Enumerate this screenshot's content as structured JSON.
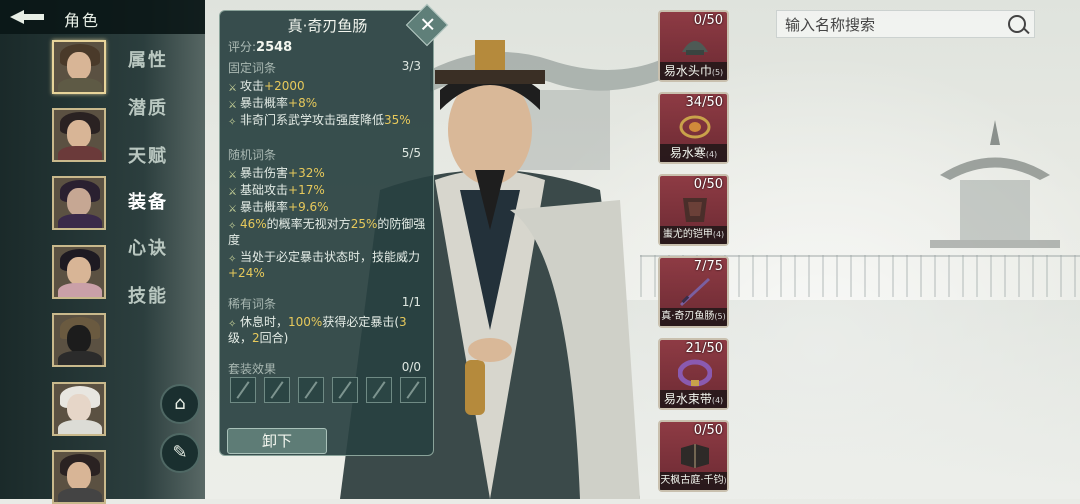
{
  "header": {
    "title": "角色"
  },
  "sidebar": {
    "menu": [
      {
        "label": "属性",
        "active": false
      },
      {
        "label": "潜质",
        "active": false
      },
      {
        "label": "天赋",
        "active": false
      },
      {
        "label": "装备",
        "active": true
      },
      {
        "label": "心诀",
        "active": false
      },
      {
        "label": "技能",
        "active": false
      }
    ],
    "buttons": [
      {
        "icon": "robe-icon"
      },
      {
        "icon": "broom-icon"
      }
    ]
  },
  "tooltip": {
    "title": "真·奇刃鱼肠",
    "score_label": "评分:",
    "score_value": "2548",
    "fixed": {
      "label": "固定词条",
      "count": "3/3",
      "lines": [
        "攻击+2000",
        "暴击概率+8%",
        "非奇门系武学攻击强度降低35%"
      ]
    },
    "random": {
      "label": "随机词条",
      "count": "5/5",
      "lines": [
        "暴击伤害+32%",
        "基础攻击+17%",
        "暴击概率+9.6%",
        "46%的概率无视对方25%的防御强度",
        "当处于必定暴击状态时，技能威力+24%"
      ]
    },
    "rare": {
      "label": "稀有词条",
      "count": "1/1",
      "lines": [
        "休息时，100%获得必定暴击(3级，2回合)"
      ]
    },
    "set": {
      "label": "套装效果",
      "count": "0/0"
    },
    "unequip_label": "卸下"
  },
  "equipment": [
    {
      "count": "0/50",
      "name": "易水头巾",
      "level": "(5)",
      "icon": "headband-icon"
    },
    {
      "count": "34/50",
      "name": "易水寒",
      "level": "(4)",
      "icon": "bracelet-icon"
    },
    {
      "count": "0/50",
      "name": "蚩尤的铠甲",
      "level": "(4)",
      "icon": "armor-icon"
    },
    {
      "count": "7/75",
      "name": "真·奇刃鱼肠",
      "level": "(5)",
      "icon": "dagger-icon"
    },
    {
      "count": "21/50",
      "name": "易水束带",
      "level": "(4)",
      "icon": "belt-icon"
    },
    {
      "count": "0/50",
      "name": "天枫古庭·千钧",
      "level": ")",
      "icon": "book-icon"
    }
  ],
  "search": {
    "placeholder": "输入名称搜索"
  },
  "colors": {
    "equip_bg": "#8e3b44",
    "highlight": "#e7c95b",
    "panel": "#284040"
  }
}
